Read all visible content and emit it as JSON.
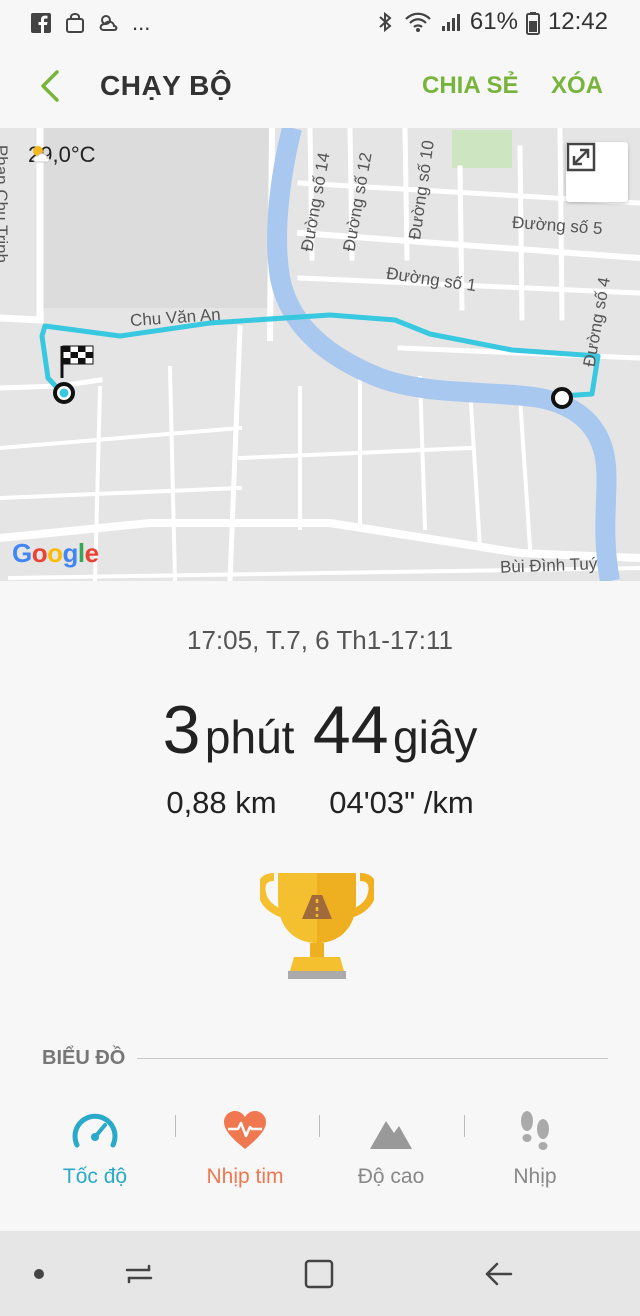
{
  "status_bar": {
    "notification_more": "...",
    "battery": "61%",
    "time": "12:42"
  },
  "app_bar": {
    "title": "CHẠY BỘ",
    "share_label": "CHIA SẺ",
    "delete_label": "XÓA"
  },
  "map": {
    "weather": "29,0°C",
    "google_logo": "Google",
    "roads": {
      "phan_chu_trinh": "Phan Chu Trinh",
      "duong_so_14": "Đường số 14",
      "duong_so_12": "Đường số 12",
      "duong_so_10": "Đường số 10",
      "duong_so_5": "Đường số 5",
      "duong_so_1": "Đường số 1",
      "chu_van_an": "Chu Văn An",
      "duong_so_4": "Đường số 4",
      "bui_dinh_tuy": "Bùi Đình Tuý"
    }
  },
  "workout": {
    "date_range": "17:05, T.7, 6 Th1-17:11",
    "minutes": "3",
    "minutes_unit": "phút",
    "seconds": "44",
    "seconds_unit": "giây",
    "distance": "0,88 km",
    "pace": "04'03\" /km"
  },
  "charts": {
    "section_label": "BIỂU ĐỒ",
    "tabs": [
      {
        "label": "Tốc độ",
        "icon": "speedometer-icon",
        "color": "#2aa9c9"
      },
      {
        "label": "Nhịp tim",
        "icon": "heart-rate-icon",
        "color": "#f07850"
      },
      {
        "label": "Độ cao",
        "icon": "mountain-icon",
        "color": "#888888"
      },
      {
        "label": "Nhịp",
        "icon": "footsteps-icon",
        "color": "#888888"
      }
    ]
  },
  "colors": {
    "accent": "#78b43c",
    "route": "#38c8e0",
    "river": "#a8c8f0",
    "trophy": "#f5c030"
  }
}
